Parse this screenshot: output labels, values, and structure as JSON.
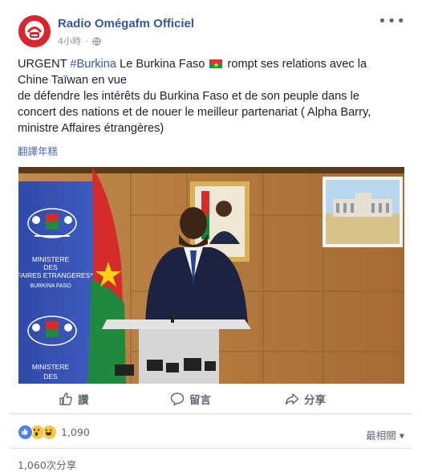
{
  "post": {
    "page_name": "Radio Omégafm Officiel",
    "time": "4小時",
    "privacy_icon": "globe-icon",
    "text": {
      "line1_prefix": "URGENT ",
      "hashtag": "#Burkina",
      "line1_mid": " Le Burkina Faso ",
      "line1_suffix": " rompt ses relations avec la",
      "line2": "Chine Taïwan en vue",
      "line3": "de défendre les intérêts du Burkina Faso et de son peuple dans le",
      "line4": "concert des nations et de nouer le meilleur partenariat ( Alpha Barry,",
      "line5": "ministre Affaires étrangères)"
    },
    "translate_link": "翻譯年糕",
    "photo": {
      "banner_line1": "MINISTERE",
      "banner_line2": "DES",
      "banner_line3": "AFFAIRES ETRANGERES*",
      "banner_line4": "BURKINA FASO",
      "banner_lower_line1": "MINISTERE",
      "banner_lower_line2": "DES"
    }
  },
  "actions": {
    "like": "讚",
    "comment": "留言",
    "share": "分享"
  },
  "footer": {
    "reaction_count": "1,090",
    "sort_label": "最相關 ▾",
    "share_count": "1,060次分享",
    "reactions": [
      "like",
      "wow",
      "haha"
    ]
  },
  "colors": {
    "link_blue": "#365899",
    "muted": "#606770",
    "flag_red": "#ef2b2d",
    "flag_green": "#009e49",
    "flag_star": "#fcd116"
  }
}
